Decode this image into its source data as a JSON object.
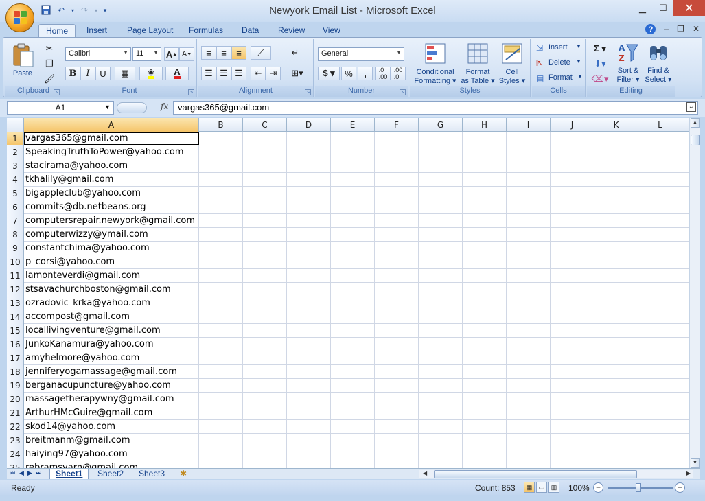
{
  "window": {
    "title": "Newyork Email List - Microsoft Excel"
  },
  "tabs": [
    "Home",
    "Insert",
    "Page Layout",
    "Formulas",
    "Data",
    "Review",
    "View"
  ],
  "ribbon": {
    "clipboard": {
      "label": "Clipboard",
      "paste": "Paste"
    },
    "font": {
      "label": "Font",
      "name": "Calibri",
      "size": "11"
    },
    "alignment": {
      "label": "Alignment"
    },
    "number": {
      "label": "Number",
      "format": "General"
    },
    "styles": {
      "label": "Styles",
      "conditional": "Conditional\nFormatting ▾",
      "format_table": "Format\nas Table ▾",
      "cell_styles": "Cell\nStyles ▾"
    },
    "cells": {
      "label": "Cells",
      "insert": "Insert",
      "delete": "Delete",
      "format": "Format"
    },
    "editing": {
      "label": "Editing",
      "sort": "Sort &\nFilter ▾",
      "find": "Find &\nSelect ▾"
    }
  },
  "formula_bar": {
    "name_box": "A1",
    "fx": "fx",
    "value": "vargas365@gmail.com"
  },
  "columns": [
    "A",
    "B",
    "C",
    "D",
    "E",
    "F",
    "G",
    "H",
    "I",
    "J",
    "K",
    "L"
  ],
  "rows": [
    "vargas365@gmail.com",
    "SpeakingTruthToPower@yahoo.com",
    "stacirama@yahoo.com",
    "tkhalily@gmail.com",
    "bigappleclub@yahoo.com",
    "commits@db.netbeans.org",
    "computersrepair.newyork@gmail.com",
    "computerwizzy@ymail.com",
    "constantchima@yahoo.com",
    "p_corsi@yahoo.com",
    "lamonteverdi@gmail.com",
    "stsavachurchboston@gmail.com",
    "ozradovic_krka@yahoo.com",
    "accompost@gmail.com",
    "locallivingventure@gmail.com",
    "JunkoKanamura@yahoo.com",
    "amyhelmore@yahoo.com",
    "jenniferyogamassage@gmail.com",
    "berganacupuncture@yahoo.com",
    "massagetherapywny@gmail.com",
    "ArthurHMcGuire@gmail.com",
    "skod14@yahoo.com",
    "breitmanm@gmail.com",
    "haiying97@yahoo.com",
    "rebramsvarn@gmail.com"
  ],
  "sheets": [
    "Sheet1",
    "Sheet2",
    "Sheet3"
  ],
  "status": {
    "ready": "Ready",
    "count": "Count: 853",
    "zoom": "100%"
  }
}
